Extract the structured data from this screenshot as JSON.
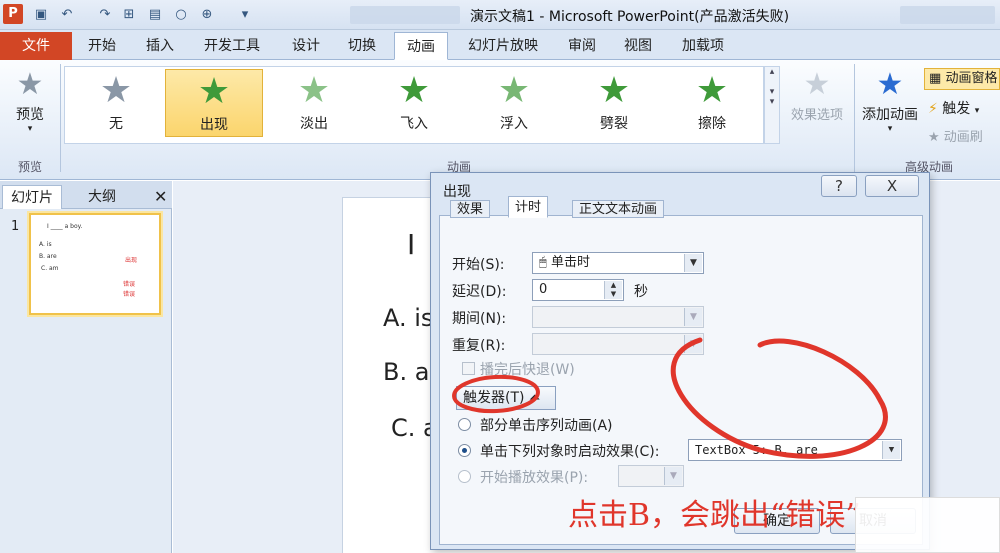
{
  "app": {
    "logo": "P",
    "title": "演示文稿1 - Microsoft PowerPoint(产品激活失败)"
  },
  "tabs": [
    "文件",
    "开始",
    "插入",
    "开发工具",
    "设计",
    "切换",
    "动画",
    "幻灯片放映",
    "审阅",
    "视图",
    "加载项"
  ],
  "ribbon": {
    "preview_label": "预览",
    "preview_group": "预览",
    "animations": [
      "无",
      "出现",
      "淡出",
      "飞入",
      "浮入",
      "劈裂",
      "擦除"
    ],
    "effect_options": "效果选项",
    "animation_group": "动画",
    "add_animation": "添加动画",
    "anim_pane": "动画窗格",
    "trigger": "触发",
    "anim_painter": "动画刷",
    "advanced_group": "高级动画"
  },
  "slide_pane": {
    "tab_slides": "幻灯片",
    "tab_outline": "大纲",
    "slide_number": "1",
    "thumb_lines": [
      "I ____ a boy.",
      "A. is",
      "B. are",
      "C. am"
    ],
    "thumb_red": [
      "出现",
      "错误",
      "错误"
    ]
  },
  "slide": {
    "line1": "I",
    "optA": "A. is",
    "optB": "B. a",
    "optC": "C. a"
  },
  "dialog": {
    "title": "出现",
    "help": "?",
    "close": "X",
    "tabs": [
      "效果",
      "计时",
      "正文文本动画"
    ],
    "start_label": "开始(S):",
    "start_value": "单击时",
    "delay_label": "延迟(D):",
    "delay_value": "0",
    "seconds": "秒",
    "duration_label": "期间(N):",
    "repeat_label": "重复(R):",
    "rewind_label": "播完后快退(W)",
    "triggers_btn": "触发器(T)",
    "opt_sequence": "部分单击序列动画(A)",
    "opt_click": "单击下列对象时启动效果(C):",
    "click_object": "TextBox 5: B.  are",
    "opt_play": "开始播放效果(P):",
    "ok": "确定",
    "cancel": "取消"
  },
  "annotation": "点击B，会跳出“错误”"
}
